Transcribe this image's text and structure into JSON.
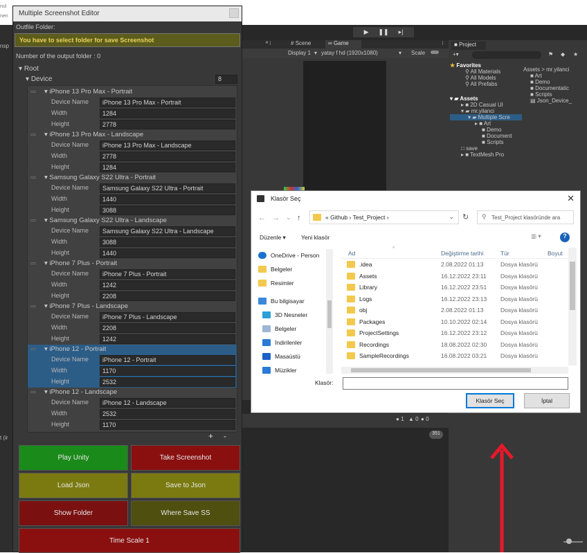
{
  "editor": {
    "title": "Multiple Screenshot Editor",
    "outfile_label": "Outfile Folder:",
    "warning": "You have to select folder for save Screenshot",
    "output_count_label": "Number of the output folder : 0",
    "root_label": "Root",
    "device_label": "Device",
    "device_count": "8",
    "field_labels": {
      "name": "Device Name",
      "width": "Width",
      "height": "Height"
    },
    "devices": [
      {
        "header": "iPhone 13 Pro Max  - Portrait",
        "name": "iPhone 13 Pro Max  - Portrait",
        "width": "1284",
        "height": "2778"
      },
      {
        "header": "iPhone 13 Pro Max  - Landscape",
        "name": "iPhone 13 Pro Max  - Landscape",
        "width": "2778",
        "height": "1284"
      },
      {
        "header": "Samsung Galaxy S22 Ultra - Portrait",
        "name": "Samsung Galaxy S22 Ultra - Portrait",
        "width": "1440",
        "height": "3088"
      },
      {
        "header": "Samsung Galaxy S22 Ultra - Landscape",
        "name": "Samsung Galaxy S22 Ultra - Landscape",
        "width": "3088",
        "height": "1440"
      },
      {
        "header": "iPhone 7 Plus  - Portrait",
        "name": "iPhone 7 Plus  - Portrait",
        "width": "1242",
        "height": "2208"
      },
      {
        "header": "iPhone 7 Plus  - Landscape",
        "name": "iPhone 7 Plus  - Landscape",
        "width": "2208",
        "height": "1242"
      },
      {
        "header": "iPhone 12 - Portrait",
        "name": "iPhone 12 - Portrait",
        "width": "1170",
        "height": "2532"
      },
      {
        "header": "iPhone 12  - Landscape",
        "name": "iPhone 12  - Landscape",
        "width": "2532",
        "height": "1170"
      }
    ],
    "plus": "+",
    "minus": "-",
    "buttons": {
      "play_unity": "Play Unity",
      "take_screenshot": "Take Screenshot",
      "load_json": "Load Json",
      "save_json": "Save to Json",
      "show_folder": "Show Folder",
      "where_save": "Where Save SS",
      "time_scale": "Time Scale 1"
    }
  },
  "unity": {
    "tab_scene": "Scene",
    "tab_game": "Game",
    "display": "Display 1",
    "resolution": "yatay f hd (1920x1080)",
    "scale": "Scale",
    "tab_project": "Project",
    "favorites": "Favorites",
    "fav_items": [
      "All Materials",
      "All Models",
      "All Prefabs"
    ],
    "assets": "Assets",
    "asset_tree": [
      "2D Casual UI",
      "mr.yilanci",
      "Multiple Scre",
      "Art",
      "Demo",
      "Document",
      "Scripts",
      "save",
      "TextMesh Pro"
    ],
    "breadcrumb": "Assets > mr.yilanci",
    "asset_list": [
      "Art",
      "Demo",
      "Documentatic",
      "Scripts",
      "Json_Device_"
    ],
    "console_counts": [
      "1",
      "0",
      "0"
    ],
    "count_badge": "351"
  },
  "dialog": {
    "title": "Klasör Seç",
    "path": [
      "Github",
      "Test_Project"
    ],
    "search_placeholder": "Test_Project klasöründe ara",
    "toolbar": {
      "organize": "Düzenle",
      "new_folder": "Yeni klasör"
    },
    "nav": [
      "OneDrive - Person",
      "Belgeler",
      "Resimler",
      "Bu bilgisayar",
      "3D Nesneler",
      "Belgeler",
      "İndirilenler",
      "Masaüstü",
      "Müzikler"
    ],
    "columns": {
      "name": "Ad",
      "date": "Değiştirme tarihi",
      "type": "Tür",
      "size": "Boyut"
    },
    "files": [
      {
        "name": ".idea",
        "date": "2.08.2022 01:13",
        "type": "Dosya klasörü"
      },
      {
        "name": "Assets",
        "date": "16.12.2022 23:11",
        "type": "Dosya klasörü"
      },
      {
        "name": "Library",
        "date": "16.12.2022 23:51",
        "type": "Dosya klasörü"
      },
      {
        "name": "Logs",
        "date": "16.12.2022 23:13",
        "type": "Dosya klasörü"
      },
      {
        "name": "obj",
        "date": "2.08.2022 01:13",
        "type": "Dosya klasörü"
      },
      {
        "name": "Packages",
        "date": "10.10.2022 02:14",
        "type": "Dosya klasörü"
      },
      {
        "name": "ProjectSettings",
        "date": "16.12.2022 23:12",
        "type": "Dosya klasörü"
      },
      {
        "name": "Recordings",
        "date": "18.08.2022 02:30",
        "type": "Dosya klasörü"
      },
      {
        "name": "SampleRecordings",
        "date": "16.08.2022 03:21",
        "type": "Dosya klasörü"
      }
    ],
    "folder_label": "Klasör:",
    "folder_value": "",
    "select_button": "Klasör Seç",
    "cancel_button": "İptal"
  },
  "colors": {
    "arrow": "#e8182a",
    "play": "#1a8a1a",
    "red": "#8a1010",
    "olive": "#7a7a10",
    "darkolive": "#4f4f10",
    "selected": "#2c5d87"
  }
}
